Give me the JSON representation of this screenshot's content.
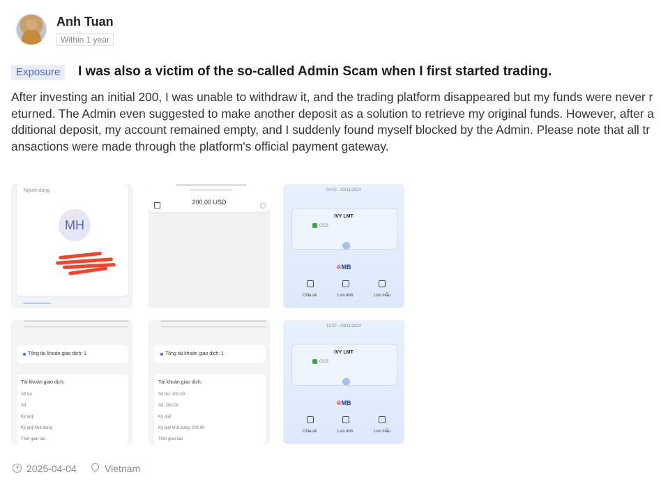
{
  "author": {
    "name": "Anh Tuan",
    "time_tag": "Within 1 year"
  },
  "post": {
    "tag": "Exposure",
    "title": "I was also a victim of the so-called Admin Scam when I first started trading.",
    "body": "After investing an initial 200, I was unable to withdraw it, and the trading platform disappeared but my funds were never returned. The Admin even suggested to make another deposit as a solution to retrieve my original funds. However, after additional deposit, my account remained empty, and I suddenly found myself blocked by the Admin. Please note that all transactions were made through the platform's official payment gateway."
  },
  "images": {
    "img1": {
      "label": "Người dùng",
      "initials": "MH"
    },
    "img2": {
      "amount": "200.00 USD"
    },
    "img3": {
      "date": "04:02 - 03/11/2024",
      "name": "IVY LMT",
      "bank": "OCB",
      "logo": "MB",
      "actions": [
        "Chia sẻ",
        "Lưu ảnh",
        "Lưu mẫu"
      ]
    },
    "img4": {
      "summary": "Tổng tài khoản giao dịch: 1",
      "account_label": "Tài khoản giao dịch:",
      "rows": [
        "Số dư",
        "Số",
        "Ký quỹ",
        "Ký quỹ khả dụng",
        "Thời gian tạo"
      ]
    },
    "img5": {
      "summary": "Tổng tài khoản giao dịch: 1",
      "account_label": "Tài khoản giao dịch:",
      "rows": [
        "Số dư: 200.00",
        "Số: 200.00",
        "Ký quỹ",
        "Ký quỹ khả dụng: 200.00",
        "Thời gian tạo"
      ]
    },
    "img6": {
      "date": "13:37 - 03/11/2024",
      "name": "IVY LMT",
      "bank": "OCB",
      "logo": "MB",
      "actions": [
        "Chia sẻ",
        "Lưu ảnh",
        "Lưu mẫu"
      ]
    }
  },
  "footer": {
    "date": "2025-04-04",
    "location": "Vietnam"
  }
}
